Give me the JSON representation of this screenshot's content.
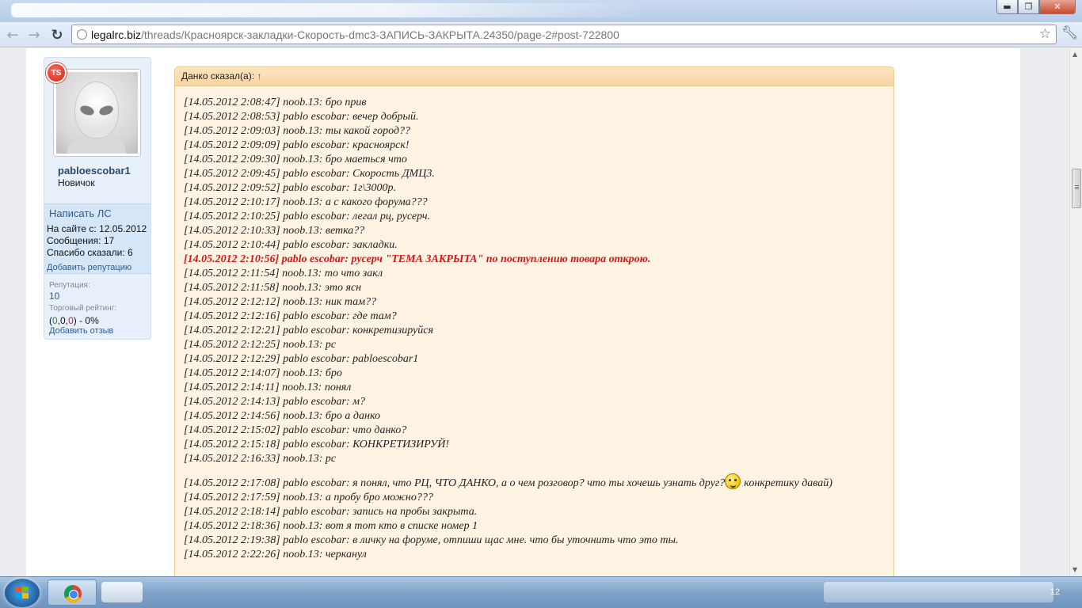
{
  "browser": {
    "url_host": "legalrc.biz",
    "url_path": "/threads/Красноярск-закладки-Скорость-dmc3-ЗАПИСЬ-ЗАКРЫТА.24350/page-2#post-722800",
    "window_buttons": {
      "minimize": "▬",
      "maximize": "❐",
      "close": "✕"
    },
    "icons": {
      "back": "back-arrow-icon",
      "forward": "forward-arrow-icon",
      "reload": "reload-icon",
      "globe": "globe-icon",
      "star": "star-icon",
      "wrench": "wrench-icon"
    }
  },
  "user": {
    "badge": "TS",
    "name": "pabloescobar1",
    "title": "Новичок",
    "pm_link": "Написать ЛС",
    "stats": [
      {
        "label": "На сайте с:",
        "value": "12.05.2012"
      },
      {
        "label": "Сообщения:",
        "value": "17"
      },
      {
        "label": "Спасибо сказали:",
        "value": "6"
      }
    ],
    "add_reputation": "Добавить репутацию",
    "reputation_label": "Репутация:",
    "reputation_value": "10",
    "trade_label": "Торговый рейтинг:",
    "trade": {
      "open": "(",
      "pos": "0",
      "neu": "0",
      "neg": "0",
      "close": ")",
      "percent": "- 0%"
    },
    "add_review": "Добавить отзыв"
  },
  "quote": {
    "author": "Данко сказал(а):",
    "up_arrow": "↑",
    "messages": [
      "[14.05.2012 2:08:47] noob.13: бро прив",
      "[14.05.2012 2:08:53] pablo escobar: вечер добрый.",
      "[14.05.2012 2:09:03] noob.13: ты какой город??",
      "[14.05.2012 2:09:09] pablo escobar: красноярск!",
      "[14.05.2012 2:09:30] noob.13: бро маеться что",
      "[14.05.2012 2:09:45] pablo escobar: Скорость ДМЦ3.",
      "[14.05.2012 2:09:52] pablo escobar: 1г\\3000р.",
      "[14.05.2012 2:10:17] noob.13: а с какого форума???",
      "[14.05.2012 2:10:25] pablo escobar: легал рц, русерч.",
      "[14.05.2012 2:10:33] noob.13: ветка??",
      "[14.05.2012 2:10:44] pablo escobar: закладки.",
      "[14.05.2012 2:10:56] pablo escobar: русерч \"ТЕМА ЗАКРЫТА\" по поступлению товара открою.",
      "[14.05.2012 2:11:54] noob.13: то что закл",
      "[14.05.2012 2:11:58] noob.13: это ясн",
      "[14.05.2012 2:12:12] noob.13: ник там??",
      "[14.05.2012 2:12:16] pablo escobar: где там?",
      "[14.05.2012 2:12:21] pablo escobar: конкретизируйся",
      "[14.05.2012 2:12:25] noob.13: рс",
      "[14.05.2012 2:12:29] pablo escobar: pabloescobar1",
      "[14.05.2012 2:14:07] noob.13: бро",
      "[14.05.2012 2:14:11] noob.13: понял",
      "[14.05.2012 2:14:13] pablo escobar: м?",
      "[14.05.2012 2:14:56] noob.13: бро а данко",
      "[14.05.2012 2:15:02] pablo escobar: что данко?",
      "[14.05.2012 2:15:18] pablo escobar: КОНКРЕТИЗИРУЙ!",
      "[14.05.2012 2:16:33] noob.13: рс"
    ],
    "long_message_text": "[14.05.2012 2:17:08] pablo escobar: я понял, что РЦ, ЧТО ДАНКО, а о чем розговор? что ты хочешь узнать друг?",
    "long_message_tail": "конкретику давай)",
    "messages_after": [
      "[14.05.2012 2:17:59] noob.13: а пробу бро можно???",
      "[14.05.2012 2:18:14] pablo escobar: запись на пробы закрыта.",
      "[14.05.2012 2:18:36] noob.13: вот я тот кто в списке номер 1",
      "[14.05.2012 2:19:38] pablo escobar: в личку на форуме, отпиши щас мне. что бы уточнить что это ты.",
      "[14.05.2012 2:22:26] noob.13: черканул"
    ]
  },
  "taskbar": {
    "clock": "12"
  }
}
